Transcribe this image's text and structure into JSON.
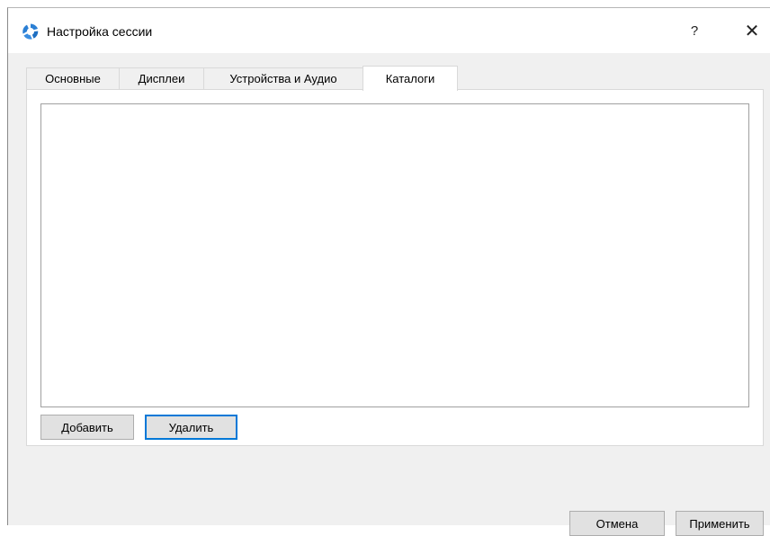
{
  "window": {
    "title": "Настройка сессии",
    "help_label": "?",
    "close_label": "✕"
  },
  "tabs": [
    {
      "label": "Основные",
      "active": false
    },
    {
      "label": "Дисплеи",
      "active": false
    },
    {
      "label": "Устройства и Аудио",
      "active": false
    },
    {
      "label": "Каталоги",
      "active": true
    }
  ],
  "catalogs": {
    "items": [],
    "add_label": "Добавить",
    "remove_label": "Удалить"
  },
  "footer": {
    "cancel_label": "Отмена",
    "apply_label": "Применить"
  },
  "colors": {
    "accent": "#0078d7",
    "dialog_bg": "#f0f0f0",
    "button_bg": "#e1e1e1",
    "icon_blue": "#2b7fd4"
  }
}
